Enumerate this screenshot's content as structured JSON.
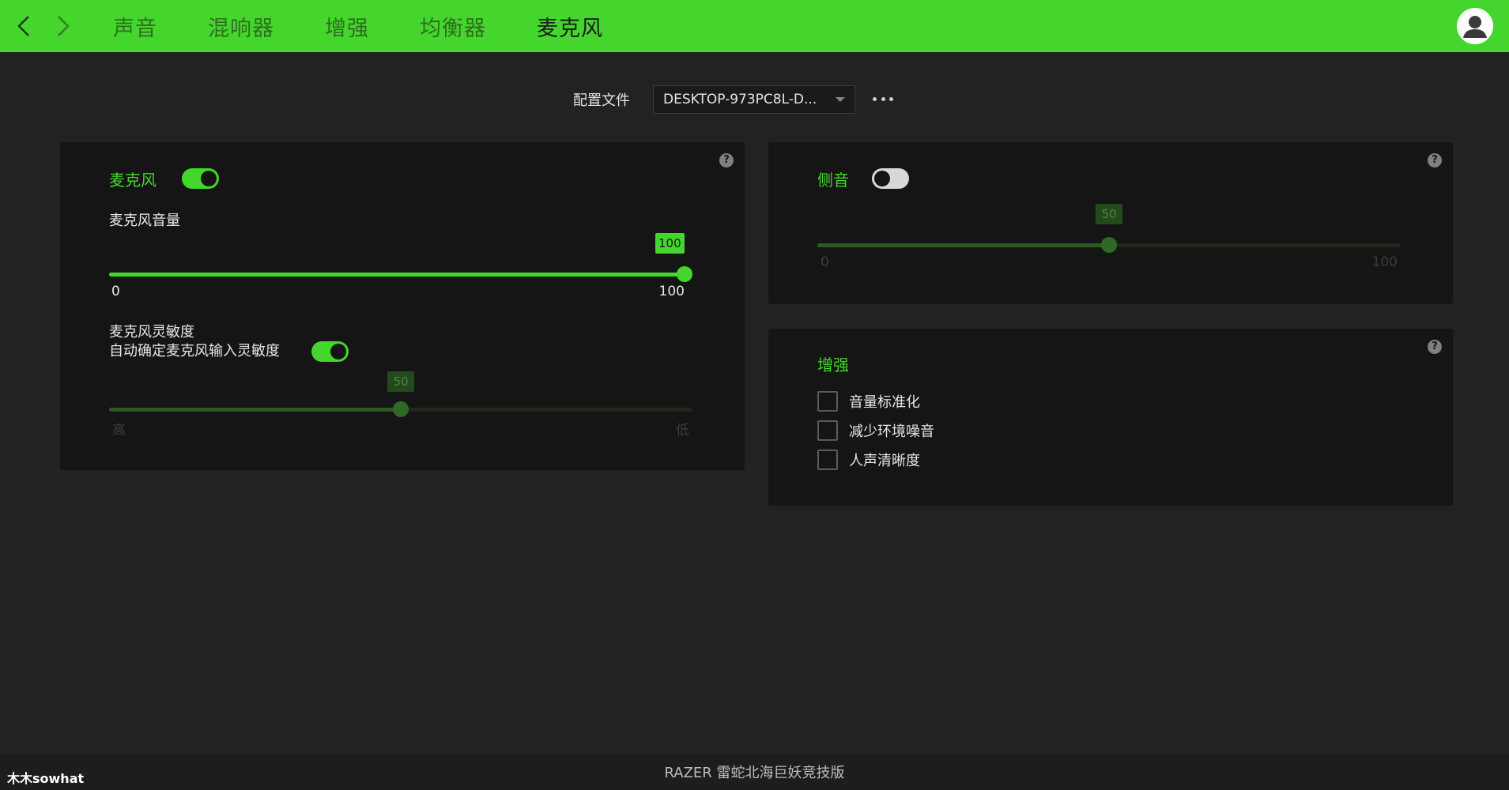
{
  "nav": {
    "back_icon": "chevron-left-icon",
    "forward_icon": "chevron-right-icon",
    "tabs": [
      {
        "label": "声音",
        "active": false
      },
      {
        "label": "混响器",
        "active": false
      },
      {
        "label": "增强",
        "active": false
      },
      {
        "label": "均衡器",
        "active": false
      },
      {
        "label": "麦克风",
        "active": true
      }
    ],
    "avatar_icon": "user-avatar-icon"
  },
  "profile": {
    "label": "配置文件",
    "selected": "DESKTOP-973PC8L-D...",
    "more_icon": "more-dots-icon"
  },
  "mic_panel": {
    "title": "麦克风",
    "toggle_on": true,
    "help": "?",
    "volume": {
      "label": "麦克风音量",
      "value": 100,
      "value_text": "100",
      "min_label": "0",
      "max_label": "100"
    },
    "sensitivity": {
      "label": "麦克风灵敏度",
      "auto_label": "自动确定麦克风输入灵敏度",
      "auto_on": true,
      "value": 50,
      "value_text": "50",
      "min_label": "高",
      "max_label": "低"
    }
  },
  "sidetone_panel": {
    "title": "侧音",
    "toggle_on": false,
    "help": "?",
    "value": 50,
    "value_text": "50",
    "min_label": "0",
    "max_label": "100"
  },
  "enhance_panel": {
    "title": "增强",
    "help": "?",
    "options": [
      {
        "label": "音量标准化",
        "checked": false
      },
      {
        "label": "减少环境噪音",
        "checked": false
      },
      {
        "label": "人声清晰度",
        "checked": false
      }
    ]
  },
  "footer": {
    "device": "RAZER 雷蛇北海巨妖竞技版",
    "watermark": "木木sowhat"
  },
  "colors": {
    "accent": "#44d62c",
    "background": "#222222",
    "panel": "#151515"
  }
}
